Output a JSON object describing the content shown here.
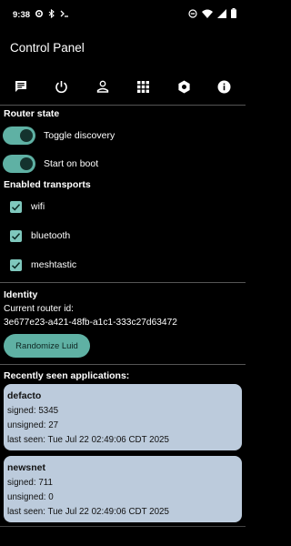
{
  "status_bar": {
    "time": "9:38"
  },
  "app": {
    "title": "Control Panel"
  },
  "toolbar": {
    "icons": [
      "chat-icon",
      "power-icon",
      "person-icon",
      "grid-icon",
      "settings-icon",
      "info-icon"
    ]
  },
  "router_state": {
    "heading": "Router state",
    "toggles": [
      {
        "label": "Toggle discovery",
        "on": true
      },
      {
        "label": "Start on boot",
        "on": true
      }
    ]
  },
  "transports": {
    "heading": "Enabled transports",
    "items": [
      {
        "label": "wifi",
        "checked": true
      },
      {
        "label": "bluetooth",
        "checked": true
      },
      {
        "label": "meshtastic",
        "checked": true
      }
    ]
  },
  "identity": {
    "heading": "Identity",
    "router_id_label": "Current router id:",
    "router_id": "3e677e23-a421-48fb-a1c1-333c27d63472",
    "randomize_label": "Randomize Luid"
  },
  "applications": {
    "heading": "Recently seen applications:",
    "items": [
      {
        "name": "defacto",
        "signed": "signed: 5345",
        "unsigned": "unsigned: 27",
        "last_seen": "last seen: Tue Jul 22 02:49:06 CDT 2025"
      },
      {
        "name": "newsnet",
        "signed": "signed: 711",
        "unsigned": "unsigned: 0",
        "last_seen": "last seen: Tue Jul 22 02:49:06 CDT 2025"
      }
    ]
  },
  "colors": {
    "accent": "#5fb1a4",
    "checkbox": "#7fc8bd",
    "card": "#bccbdc",
    "background": "#000000"
  }
}
